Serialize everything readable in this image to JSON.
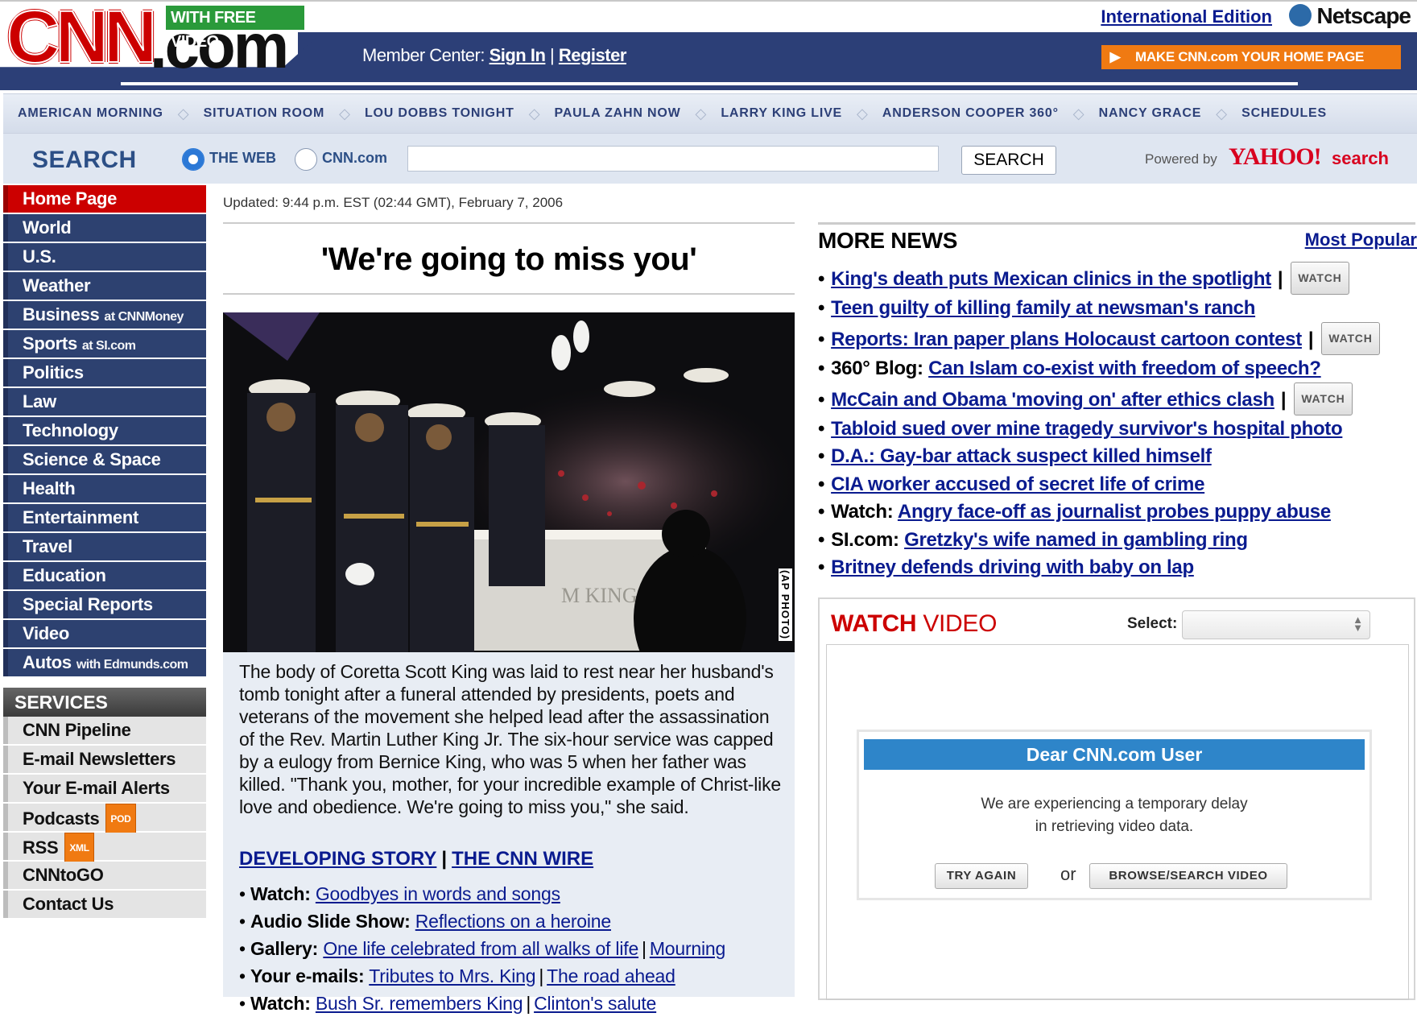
{
  "header": {
    "logo_text": "CNN",
    "logo_suffix": ".com",
    "free_video_badge": "WITH FREE VIDEO",
    "member_center_label": "Member Center:",
    "sign_in": "Sign In",
    "separator": "|",
    "register": "Register",
    "international_edition": "International Edition",
    "netscape": "Netscape",
    "make_home": "MAKE CNN.com YOUR HOME PAGE"
  },
  "nav": {
    "items": [
      "AMERICAN MORNING",
      "SITUATION ROOM",
      "LOU DOBBS TONIGHT",
      "PAULA ZAHN NOW",
      "LARRY KING LIVE",
      "ANDERSON COOPER 360°",
      "NANCY GRACE",
      "SCHEDULES"
    ]
  },
  "search": {
    "label": "SEARCH",
    "option_web": "THE WEB",
    "option_cnn": "CNN.com",
    "selected_option": "THE WEB",
    "input_value": "",
    "button": "SEARCH",
    "powered_by": "Powered by",
    "yahoo": "YAHOO!",
    "yahoo_search": "search"
  },
  "sidebar": {
    "items": [
      {
        "label": "Home Page",
        "suffix": "",
        "active": true
      },
      {
        "label": "World",
        "suffix": ""
      },
      {
        "label": "U.S.",
        "suffix": ""
      },
      {
        "label": "Weather",
        "suffix": ""
      },
      {
        "label": "Business",
        "suffix": "at CNNMoney"
      },
      {
        "label": "Sports",
        "suffix": "at SI.com"
      },
      {
        "label": "Politics",
        "suffix": ""
      },
      {
        "label": "Law",
        "suffix": ""
      },
      {
        "label": "Technology",
        "suffix": ""
      },
      {
        "label": "Science & Space",
        "suffix": ""
      },
      {
        "label": "Health",
        "suffix": ""
      },
      {
        "label": "Entertainment",
        "suffix": ""
      },
      {
        "label": "Travel",
        "suffix": ""
      },
      {
        "label": "Education",
        "suffix": ""
      },
      {
        "label": "Special Reports",
        "suffix": ""
      },
      {
        "label": "Video",
        "suffix": ""
      },
      {
        "label": "Autos",
        "suffix": "with Edmunds.com"
      }
    ],
    "services_heading": "SERVICES",
    "services": [
      {
        "label": "CNN Pipeline",
        "tag": ""
      },
      {
        "label": "E-mail Newsletters",
        "tag": ""
      },
      {
        "label": "Your E-mail Alerts",
        "tag": ""
      },
      {
        "label": "Podcasts",
        "tag": "POD"
      },
      {
        "label": "RSS",
        "tag": "XML"
      },
      {
        "label": "CNNtoGO",
        "tag": ""
      },
      {
        "label": "Contact Us",
        "tag": ""
      }
    ]
  },
  "main": {
    "updated": "Updated: 9:44 p.m. EST (02:44 GMT), February 7, 2006",
    "headline": "'We're going to miss you'",
    "photo_credit": "(AP PHOTO)",
    "photo_caption_text": "M KING",
    "body": "The body of Coretta Scott King was laid to rest near her husband's tomb tonight after a funeral attended by presidents, poets and veterans of the movement she helped lead after the assassination of the Rev. Martin Luther King Jr. The six-hour service was capped by a eulogy from Bernice King, who was 5 when her father was killed. \"Thank you, mother, for your incredible example of Christ-like love and obedience. We're going to miss you,\" she said.",
    "developing_story": "DEVELOPING STORY",
    "cnn_wire": "THE CNN WIRE",
    "related": [
      {
        "prefix": "Watch:",
        "links": [
          "Goodbyes in words and songs"
        ]
      },
      {
        "prefix": "Audio Slide Show:",
        "links": [
          "Reflections on a heroine"
        ]
      },
      {
        "prefix": "Gallery:",
        "links": [
          "One life celebrated from all walks of life",
          "Mourning"
        ]
      },
      {
        "prefix": "Your e-mails:",
        "links": [
          "Tributes to Mrs. King",
          "The road ahead"
        ]
      },
      {
        "prefix": "Watch:",
        "links": [
          "Bush Sr. remembers King",
          "Clinton's salute"
        ]
      }
    ]
  },
  "more_news": {
    "heading": "MORE NEWS",
    "most_popular": "Most Popular",
    "watch_label": "WATCH",
    "items": [
      {
        "prefix": "",
        "text": "King's death puts Mexican clinics in the spotlight",
        "watch": true
      },
      {
        "prefix": "",
        "text": "Teen guilty of killing family at newsman's ranch",
        "watch": false
      },
      {
        "prefix": "",
        "text": "Reports: Iran paper plans Holocaust cartoon contest",
        "watch": true
      },
      {
        "prefix": "360° Blog:",
        "text": "Can Islam co-exist with freedom of speech?",
        "watch": false
      },
      {
        "prefix": "",
        "text": "McCain and Obama 'moving on' after ethics clash",
        "watch": true
      },
      {
        "prefix": "",
        "text": "Tabloid sued over mine tragedy survivor's hospital photo",
        "watch": false
      },
      {
        "prefix": "",
        "text": "D.A.: Gay-bar attack suspect killed himself",
        "watch": false
      },
      {
        "prefix": "",
        "text": "CIA worker accused of secret life of crime",
        "watch": false
      },
      {
        "prefix": "Watch:",
        "text": "Angry face-off as journalist probes puppy abuse",
        "watch": false
      },
      {
        "prefix": "SI.com:",
        "text": "Gretzky's wife named in gambling ring",
        "watch": false
      },
      {
        "prefix": "",
        "text": "Britney defends driving with baby on lap",
        "watch": false
      }
    ]
  },
  "watch_video": {
    "title_bold": "WATCH",
    "title_rest": "VIDEO",
    "select_label": "Select:",
    "select_value": "",
    "dialog_title": "Dear CNN.com User",
    "message_line1": "We are experiencing a temporary delay",
    "message_line2": "in retrieving video data.",
    "try_again": "TRY AGAIN",
    "or": "or",
    "browse": "BROWSE/SEARCH VIDEO"
  },
  "colors": {
    "brand_red": "#cc0000",
    "nav_blue": "#2d4170",
    "link_blue": "#0a1b8f",
    "dialog_blue": "#2e85c9",
    "accent_orange": "#f07a12"
  }
}
